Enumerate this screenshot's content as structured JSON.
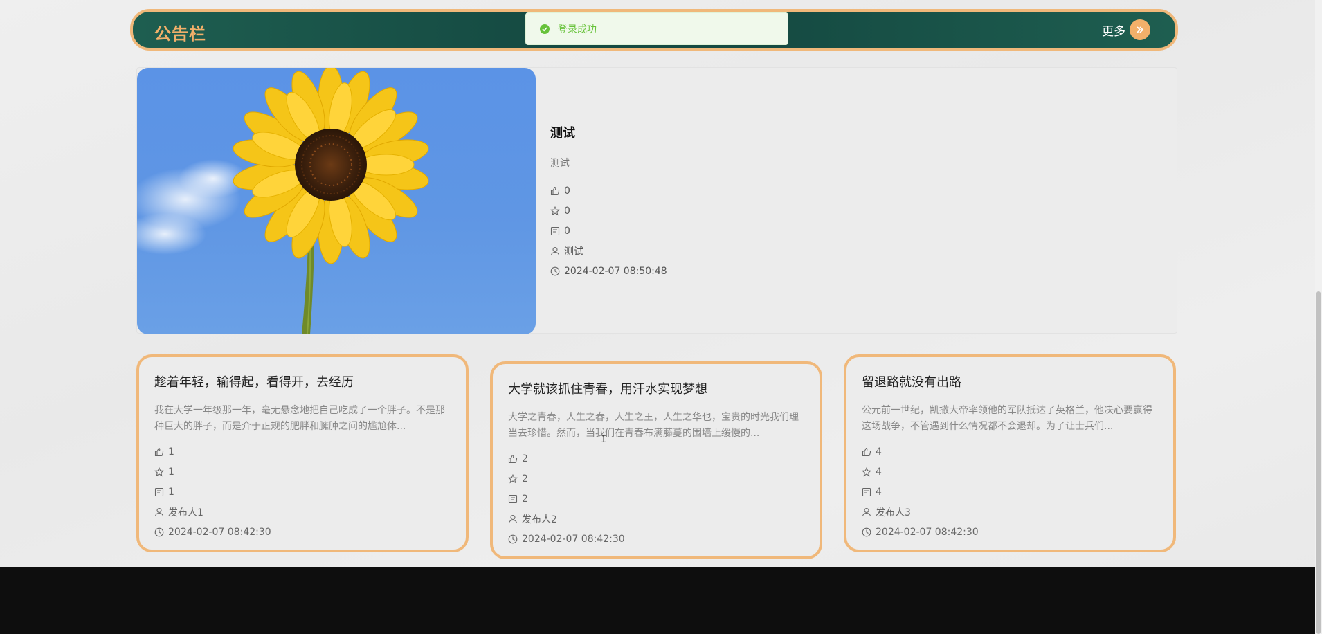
{
  "notice": {
    "title": "公告栏",
    "more_label": "更多"
  },
  "toast": {
    "message": "登录成功",
    "color": "#67c23a"
  },
  "featured": {
    "image_subject": "sunflower",
    "title": "测试",
    "subtitle": "测试",
    "likes": "0",
    "favorites": "0",
    "comments": "0",
    "author": "测试",
    "time": "2024-02-07 08:50:48"
  },
  "cards": [
    {
      "title": "趁着年轻，输得起，看得开，去经历",
      "desc": "我在大学一年级那一年，毫无悬念地把自己吃成了一个胖子。不是那种巨大的胖子，而是介于正规的肥胖和臃肿之间的尴尬体...",
      "likes": "1",
      "favorites": "1",
      "comments": "1",
      "author": "发布人1",
      "time": "2024-02-07 08:42:30"
    },
    {
      "title": "大学就该抓住青春，用汗水实现梦想",
      "desc": "大学之青春，人生之春，人生之王，人生之华也，宝贵的时光我们理当去珍惜。然而，当我们在青春布满藤蔓的围墙上缓慢的...",
      "likes": "2",
      "favorites": "2",
      "comments": "2",
      "author": "发布人2",
      "time": "2024-02-07 08:42:30"
    },
    {
      "title": "留退路就没有出路",
      "desc": "公元前一世纪，凯撒大帝率领他的军队抵达了英格兰，他决心要赢得这场战争，不管遇到什么情况都不会退却。为了让士兵们...",
      "likes": "4",
      "favorites": "4",
      "comments": "4",
      "author": "发布人3",
      "time": "2024-02-07 08:42:30"
    }
  ],
  "colors": {
    "accent": "#f0b87a",
    "bar_bg": "#154a42",
    "footer_bg": "#0e0e0e"
  }
}
